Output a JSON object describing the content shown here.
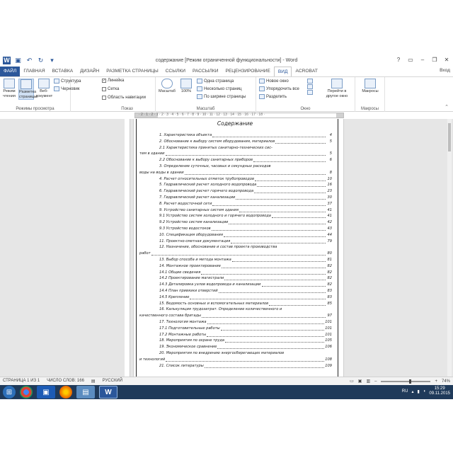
{
  "window": {
    "title": "содержание [Режим ограниченной функциональности] - Word",
    "minimize": "–",
    "restore": "❐",
    "close": "✕",
    "help": "?",
    "ribbon_toggle": "▭"
  },
  "qat": [
    "save-icon",
    "undo-icon",
    "redo-icon",
    "customize-icon"
  ],
  "tabs": [
    "ФАЙЛ",
    "ГЛАВНАЯ",
    "ВСТАВКА",
    "ДИЗАЙН",
    "РАЗМЕТКА СТРАНИЦЫ",
    "ССЫЛКИ",
    "РАССЫЛКИ",
    "РЕЦЕНЗИРОВАНИЕ",
    "ВИД",
    "ACROBAT"
  ],
  "active_tab": "ВИД",
  "user": "Вход",
  "ribbon": {
    "views": {
      "name": "Режимы просмотра",
      "read": "Режим чтения",
      "layout": "Разметка страницы",
      "web": "Веб-документ",
      "structure": "Структура",
      "draft": "Черновик"
    },
    "show": {
      "name": "Показ",
      "ruler": "Линейка",
      "grid": "Сетка",
      "nav": "Область навигации",
      "ruler_checked": true,
      "grid_checked": false,
      "nav_checked": false
    },
    "zoom": {
      "name": "Масштаб",
      "zoom": "Масштаб",
      "hundred": "100%",
      "one_page": "Одна страница",
      "multi_page": "Несколько страниц",
      "page_width": "По ширине страницы"
    },
    "window": {
      "name": "Окно",
      "new_window": "Новое окно",
      "arrange": "Упорядочить все",
      "split": "Разделить",
      "switch": "Перейти в другое окно"
    },
    "macros": {
      "name": "Макросы",
      "macros": "Макросы"
    }
  },
  "ruler": {
    "ticks": "· 2 · 1 · 2 · 1 · 2 · 3 · 4 · 5 · 6 · 7 · 8 · 9 · 10 · 11 · 12 · 13 · 14 · 15 · 16 · 17 · 18 ·"
  },
  "document": {
    "title": "Содержание",
    "toc": [
      {
        "text": "1.  Характеристика объекта",
        "page": "4"
      },
      {
        "text": "2.  Обоснование к выбору систем оборудования, материалов",
        "page": "5"
      },
      {
        "text": "2.1  Характеристика принятых санитарно-технических сис-",
        "page": ""
      },
      {
        "text": "тем в здании",
        "page": "5"
      },
      {
        "text": "2.2  Обоснование к выбору санитарных приборов",
        "page": "6"
      },
      {
        "text": "3.  Определение суточных, часовых и секундных расходов",
        "page": ""
      },
      {
        "text": "воды на воды в здании",
        "page": "8"
      },
      {
        "text": "4.  Расчет относительных отметок трубопроводов",
        "page": "10"
      },
      {
        "text": "5.  Гидравлический расчет холодного водопровода",
        "page": "16"
      },
      {
        "text": "6.  Гидравлический расчет горячего водопровода",
        "page": "23"
      },
      {
        "text": "7.  Гидравлический расчет канализации",
        "page": "30"
      },
      {
        "text": "8.  Расчет водосточной сети",
        "page": "37"
      },
      {
        "text": "9.  Устройство санитарных систем здания",
        "page": "41"
      },
      {
        "text": "9.1  Устройство систем холодного и горячего водопровода",
        "page": "41"
      },
      {
        "text": "9.2  Устройство систем канализации",
        "page": "42"
      },
      {
        "text": "9.3  Устройство водостоков",
        "page": "43"
      },
      {
        "text": "10.  Спецификация оборудования",
        "page": "44"
      },
      {
        "text": "11.  Проектно-сметная документация",
        "page": "79"
      },
      {
        "text": "12.  Назначение, обоснование и состав проекта производства",
        "page": ""
      },
      {
        "text": "работ",
        "page": "80"
      },
      {
        "text": "13.  Выбор способа и метода монтажа",
        "page": "81"
      },
      {
        "text": "14.  Монтажное проектирование",
        "page": "82"
      },
      {
        "text": "14.1  Общие сведения",
        "page": "82"
      },
      {
        "text": "14.2  Проектирование магистрали",
        "page": "82"
      },
      {
        "text": "14.3  Деталировка узлов водопровода и канализации",
        "page": "82"
      },
      {
        "text": "14.4  План привязки отверстий",
        "page": "83"
      },
      {
        "text": "14.5  Крепление",
        "page": "83"
      },
      {
        "text": "15.  Ведомость основных и вспомогательных материалов",
        "page": "85"
      },
      {
        "text": "16.  Калькуляция трудозатрат. Определение количественного и",
        "page": ""
      },
      {
        "text": "качественного состава бригады",
        "page": "97"
      },
      {
        "text": "17.  Технология монтажа",
        "page": "101"
      },
      {
        "text": "17.1  Подготовительные работы",
        "page": "101"
      },
      {
        "text": "17.2  Монтажные работы",
        "page": "101"
      },
      {
        "text": "18.  Мероприятия по охране труда",
        "page": "105"
      },
      {
        "text": "19.  Экономическое сравнение",
        "page": "106"
      },
      {
        "text": "20.  Мероприятия по внедрению энергосберегающих материалов",
        "page": ""
      },
      {
        "text": "и технологий",
        "page": "108"
      },
      {
        "text": "21.  Список литературы",
        "page": "109"
      }
    ]
  },
  "statusbar": {
    "page": "СТРАНИЦА 1 ИЗ 1",
    "words": "ЧИСЛО СЛОВ: 166",
    "lang": "РУССКИЙ",
    "zoom": "74%",
    "minus": "–",
    "plus": "+"
  },
  "taskbar": {
    "lang": "RU",
    "time": "15:29",
    "date": "09.11.2015",
    "apps": [
      "windows-start-icon",
      "chrome-icon",
      "save-app-icon",
      "firefox-icon",
      "explorer-icon",
      "word-icon"
    ]
  }
}
